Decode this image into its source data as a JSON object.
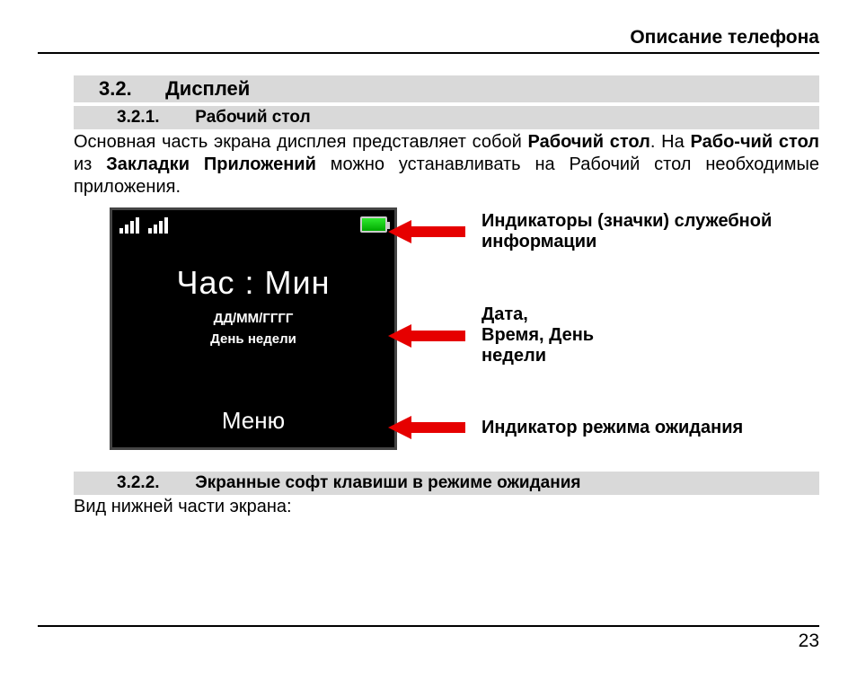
{
  "header": {
    "title": "Описание телефона"
  },
  "section": {
    "num": "3.2.",
    "title": "Дисплей",
    "sub1": {
      "num": "3.2.1.",
      "title": "Рабочий стол"
    },
    "sub2": {
      "num": "3.2.2.",
      "title": "Экранные софт клавиши в режиме ожидания"
    }
  },
  "paragraph": {
    "t1": "Основная часть экрана дисплея представляет собой ",
    "b1": "Рабочий стол",
    "t2": ". На ",
    "b2": "Рабо-чий стол",
    "t3": " из ",
    "b3": "Закладки Приложений",
    "t4": " можно устанавливать на Рабочий стол необходимые приложения."
  },
  "screen": {
    "clock": "Час : Мин",
    "date": "ДД/ММ/ГГГГ",
    "dow": "День недели",
    "menu": "Меню"
  },
  "callouts": {
    "c1": "Индикаторы (значки) служебной информации",
    "c2": "Дата,\nВремя, День\nнедели",
    "c3": "Индикатор режима ожидания"
  },
  "body2": "Вид нижней части экрана:",
  "page": "23"
}
